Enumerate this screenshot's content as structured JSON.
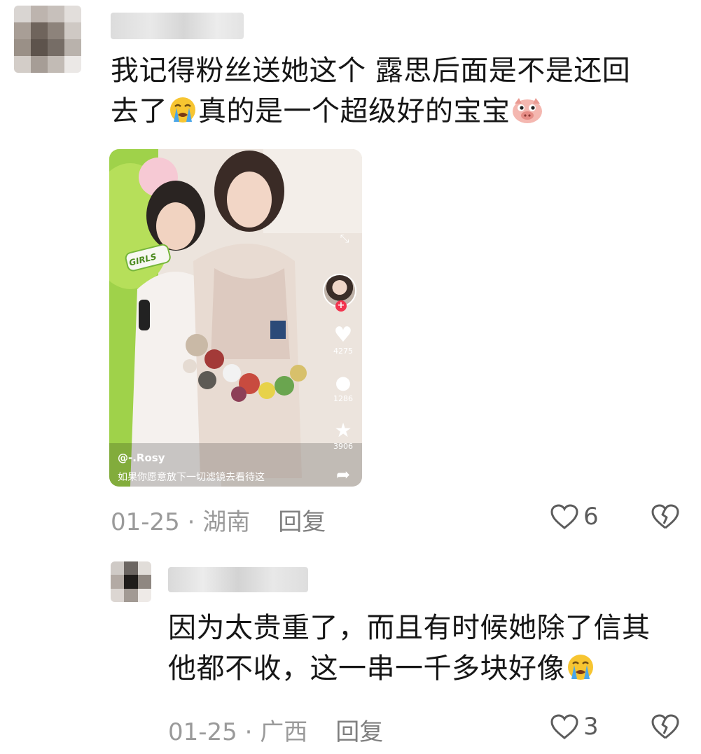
{
  "comment1": {
    "text_line1": "我记得粉丝送她这个 露思后面是不是还回",
    "text_line2a": "去了",
    "text_line2b": "真的是一个超级好的宝宝",
    "date": "01-25",
    "separator": " · ",
    "location": "湖南",
    "reply_label": "回复",
    "like_count": "6",
    "emoji_1": "loudly-crying-emoji",
    "emoji_2": "pig-face-emoji"
  },
  "video": {
    "author_handle": "@-.Rosy",
    "caption": "如果你愿意放下一切滤镜去看待这",
    "likes": "4275",
    "comments": "1286",
    "favorites": "3906",
    "badge_text": "GIRLS"
  },
  "comment2": {
    "text_line1": "因为太贵重了，而且有时候她除了信其",
    "text_line2": "他都不收，这一串一千多块好像",
    "date": "01-25",
    "separator": " · ",
    "location": "广西",
    "reply_label": "回复",
    "like_count": "3",
    "emoji_1": "loudly-crying-emoji"
  },
  "colors": {
    "text": "#161616",
    "meta": "#9a9a9a",
    "icon": "#5c5c5c"
  }
}
